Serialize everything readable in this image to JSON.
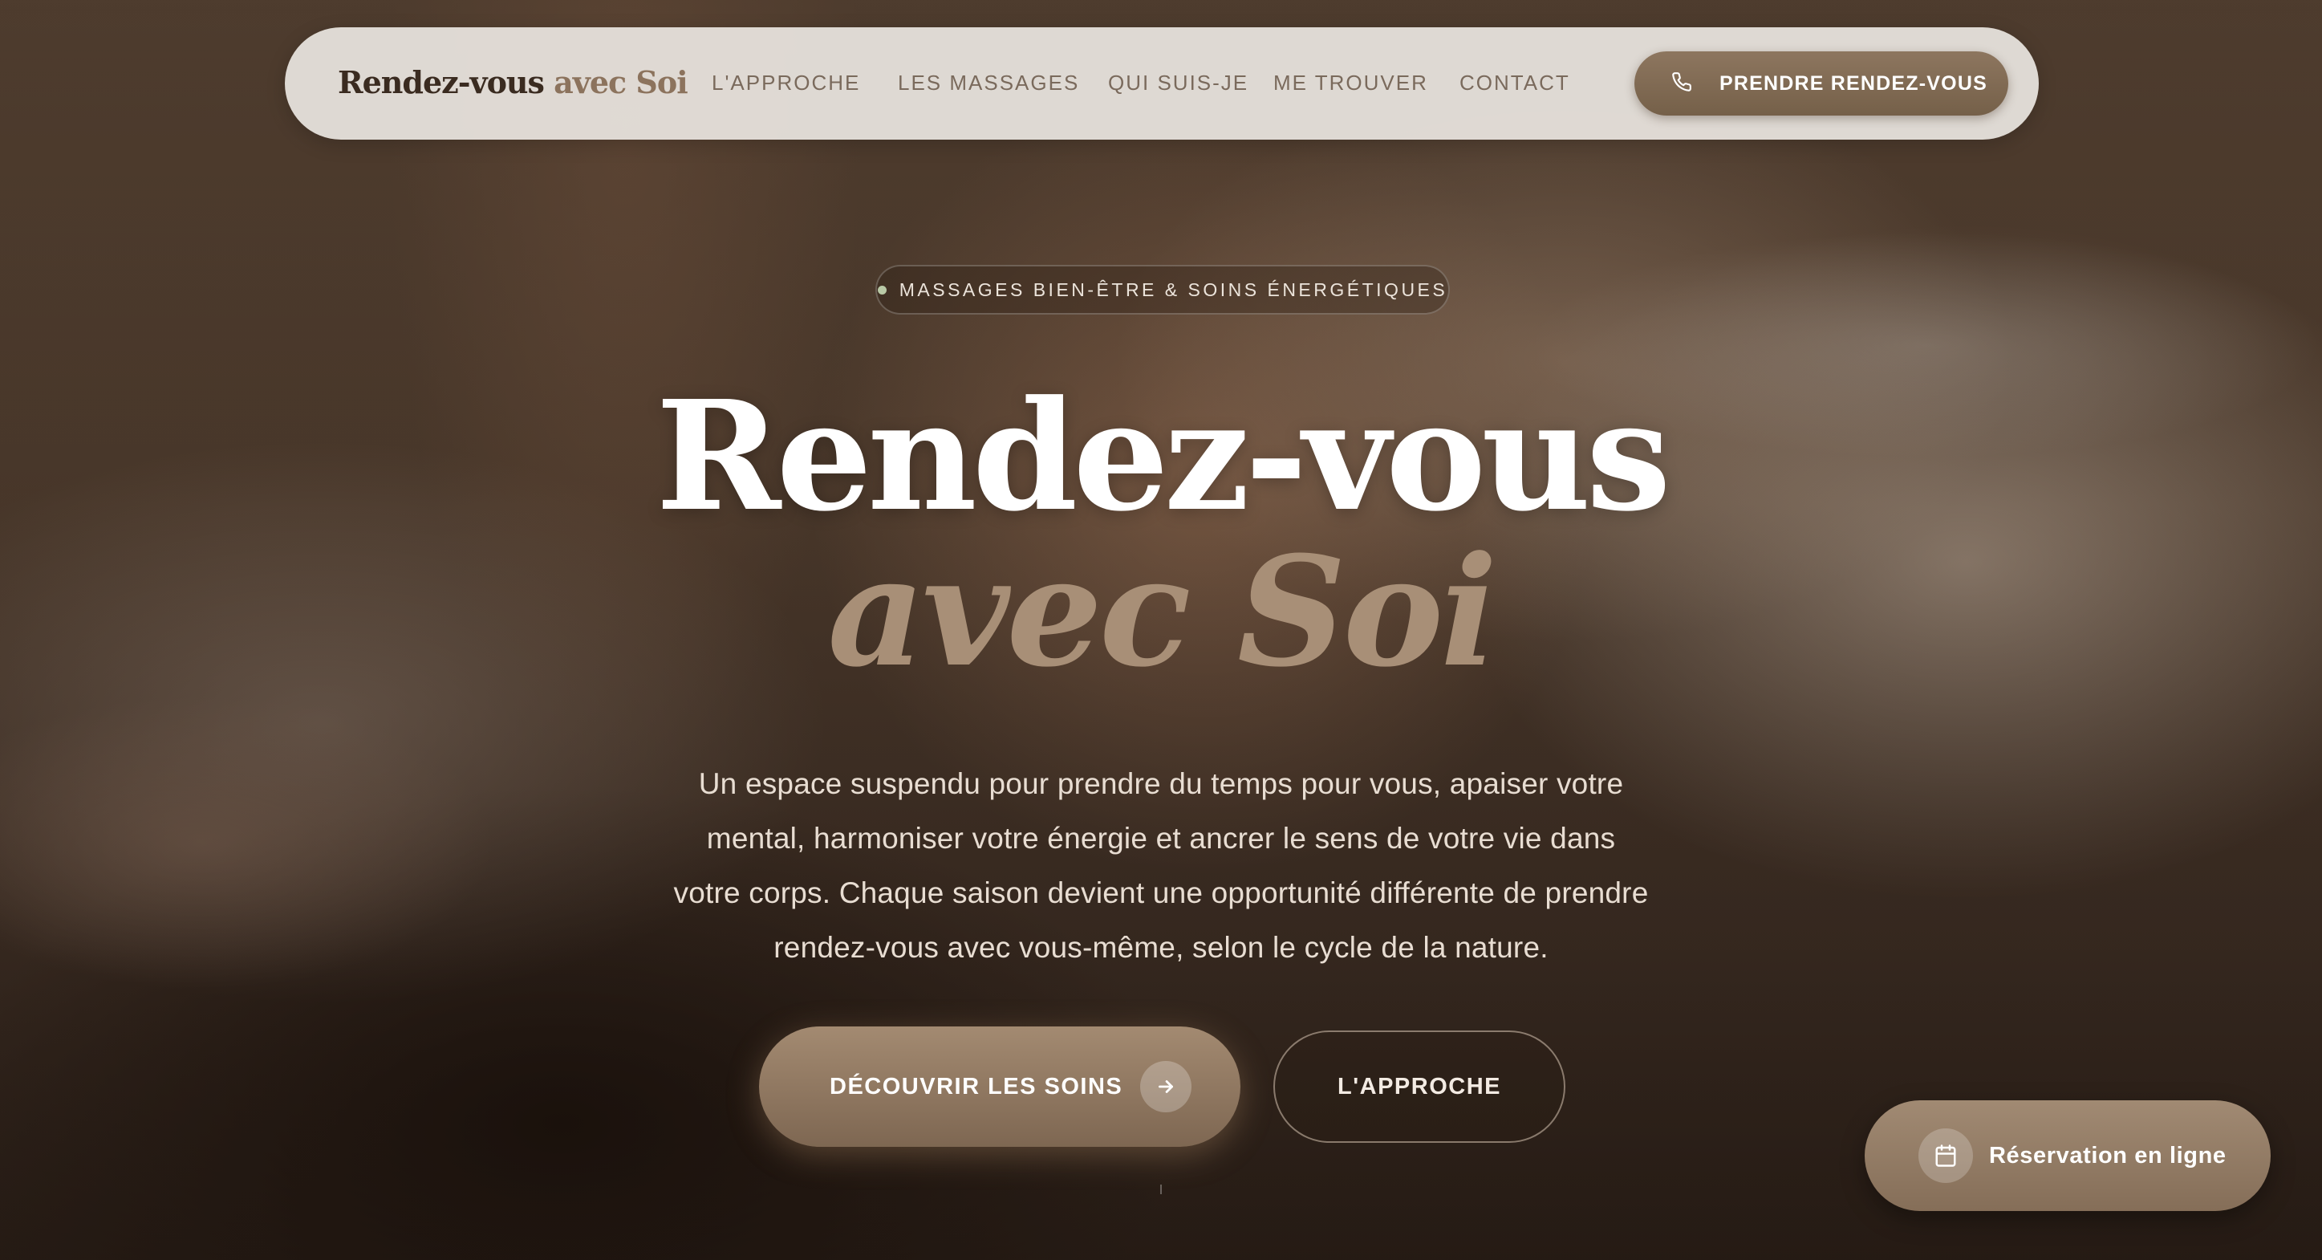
{
  "brand": {
    "part1": "Rendez-vous",
    "part2": "avec Soi"
  },
  "nav": {
    "links": [
      "L'APPROCHE",
      "LES MASSAGES",
      "QUI SUIS-JE",
      "ME TROUVER",
      "CONTACT"
    ],
    "cta_label": "PRENDRE RENDEZ-VOUS",
    "cta_icon": "phone-icon"
  },
  "hero": {
    "tag": "MASSAGES BIEN-ÊTRE & SOINS ÉNERGÉTIQUES",
    "title_line1": "Rendez-vous",
    "title_line2": "avec Soi",
    "lede": "Un espace suspendu pour prendre du temps pour vous, apaiser votre mental, harmoniser votre énergie et ancrer le sens de votre vie dans votre corps. Chaque saison devient une opportunité différente de prendre rendez-vous avec vous-même, selon le cycle de la nature.",
    "primary_button": "DÉCOUVRIR LES SOINS",
    "primary_icon": "arrow-right-icon",
    "secondary_button": "L'APPROCHE"
  },
  "floating": {
    "label": "Réservation en ligne",
    "icon": "calendar-icon"
  },
  "colors": {
    "accent": "#8c735d",
    "title_italic": "#a88f77",
    "nav_bg": "#eae5e0",
    "tag_dot": "#b9c9a6"
  }
}
